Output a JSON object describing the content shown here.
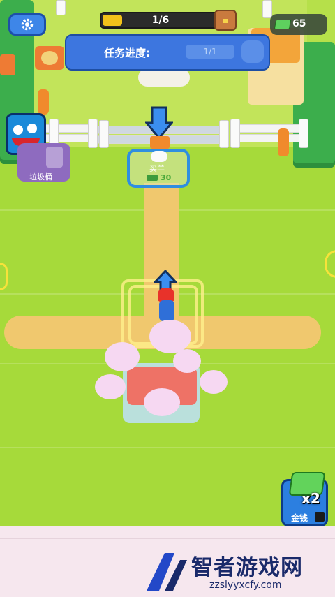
{
  "hud": {
    "progress_text": "1/6",
    "progress_fraction": 0.17,
    "money": "65",
    "settings_icon": "gear-icon",
    "chest_icon": "treasure-chest-icon",
    "money_icon": "cash-icon"
  },
  "task": {
    "label": "任务进度:",
    "count": "1/1"
  },
  "map": {
    "trash_label": "垃圾桶",
    "buy_title": "买羊",
    "buy_price": "30"
  },
  "boost": {
    "multiplier": "x2",
    "label": "金钱"
  },
  "watermark": {
    "brand": "智者游戏网",
    "url": "zzslyyxcfy.com"
  },
  "colors": {
    "accent_blue": "#3d76df",
    "grass": "#a6da3a",
    "path": "#f0c86e",
    "progress_fill": "#f2c21a"
  }
}
